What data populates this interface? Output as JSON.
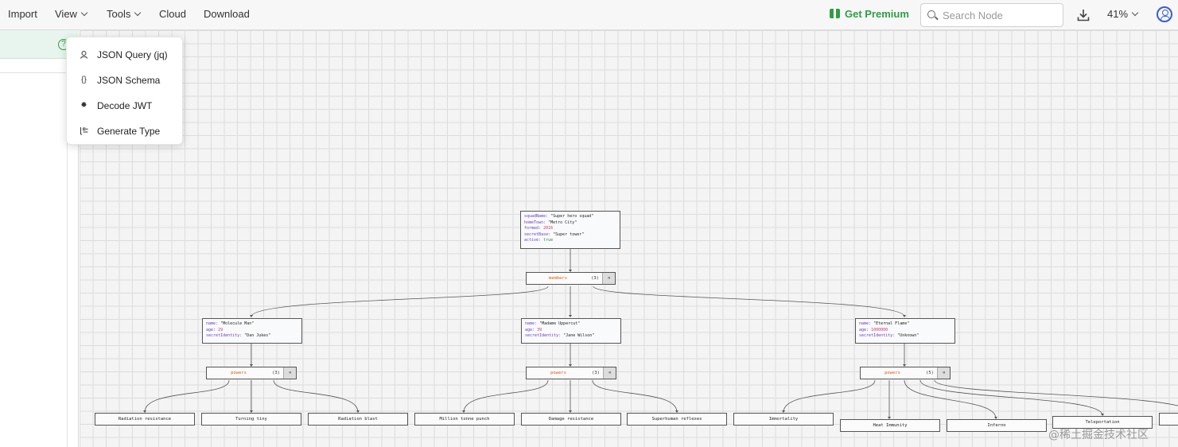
{
  "topbar": {
    "menus": [
      "Import",
      "View",
      "Tools",
      "Cloud",
      "Download"
    ],
    "premium_label": "Get Premium",
    "search_placeholder": "Search Node",
    "zoom": "41%"
  },
  "tools_menu": {
    "items": [
      {
        "label": "JSON Query (jq)",
        "icon": "search-person-icon"
      },
      {
        "label": "JSON Schema",
        "icon": "braces-icon"
      },
      {
        "label": "Decode JWT",
        "icon": "gear-icon"
      },
      {
        "label": "Generate Type",
        "icon": "type-list-icon"
      }
    ]
  },
  "graph": {
    "root": {
      "squadName_key": "squadName:",
      "squadName": "\"Super hero squad\"",
      "homeTown_key": "homeTown:",
      "homeTown": "\"Metro City\"",
      "formed_key": "formed:",
      "formed": "2016",
      "secretBase_key": "secretBase:",
      "secretBase": "\"Super tower\"",
      "active_key": "active:",
      "active": "true"
    },
    "members": {
      "name": "members",
      "count": "(3)",
      "toggle": "⌫"
    },
    "heroes": [
      {
        "name_key": "name:",
        "name": "\"Molecule Man\"",
        "age_key": "age:",
        "age": "29",
        "secret_key": "secretIdentity:",
        "secret": "\"Dan Jukes\"",
        "powers": {
          "name": "powers",
          "count": "(3)",
          "toggle": "⌫"
        },
        "power_list": [
          "Radiation resistance",
          "Turning tiny",
          "Radiation blast"
        ]
      },
      {
        "name_key": "name:",
        "name": "\"Madame Uppercut\"",
        "age_key": "age:",
        "age": "39",
        "secret_key": "secretIdentity:",
        "secret": "\"Jane Wilson\"",
        "powers": {
          "name": "powers",
          "count": "(3)",
          "toggle": "⌫"
        },
        "power_list": [
          "Million tonne punch",
          "Damage resistance",
          "Superhuman reflexes"
        ]
      },
      {
        "name_key": "name:",
        "name": "\"Eternal Flame\"",
        "age_key": "age:",
        "age": "1000000",
        "secret_key": "secretIdentity:",
        "secret": "\"Unknown\"",
        "powers": {
          "name": "powers",
          "count": "(5)",
          "toggle": "⌫"
        },
        "power_list": [
          "Immortality",
          "Heat Immunity",
          "Inferno",
          "Teleportation",
          ""
        ]
      }
    ]
  },
  "watermark": "@稀土掘金技术社区"
}
